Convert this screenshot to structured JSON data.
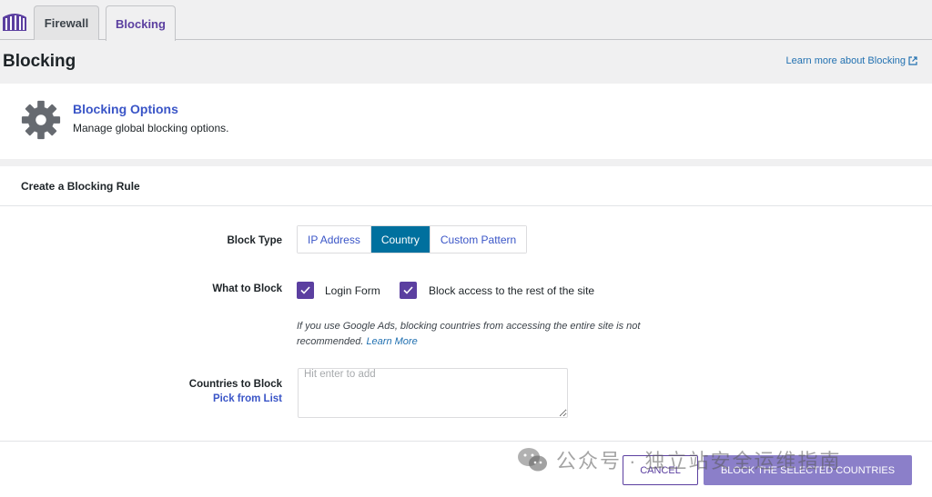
{
  "tabs": [
    {
      "label": "Firewall"
    },
    {
      "label": "Blocking"
    }
  ],
  "page": {
    "title": "Blocking",
    "learn_more": "Learn more about Blocking"
  },
  "options": {
    "title": "Blocking Options",
    "description": "Manage global blocking options."
  },
  "rule": {
    "heading": "Create a Blocking Rule",
    "block_type_label": "Block Type",
    "block_types": [
      "IP Address",
      "Country",
      "Custom Pattern"
    ],
    "selected_block_type": "Country",
    "what_label": "What to Block",
    "options": [
      {
        "label": "Login Form",
        "checked": true
      },
      {
        "label": "Block access to the rest of the site",
        "checked": true
      }
    ],
    "note": "If you use Google Ads, blocking countries from accessing the entire site is not recommended.",
    "note_link": "Learn More",
    "countries_label": "Countries to Block",
    "pick_label": "Pick from List",
    "countries_placeholder": "Hit enter to add",
    "cancel_label": "Cancel",
    "submit_label": "Block the Selected Countries"
  },
  "colors": {
    "accent": "#5b3fa0",
    "active_segment": "#00709e",
    "link": "#3a55c7",
    "submit_disabled": "#8b7fc9"
  },
  "watermark": {
    "text": "公众号 · 独立站安全运维指南"
  }
}
